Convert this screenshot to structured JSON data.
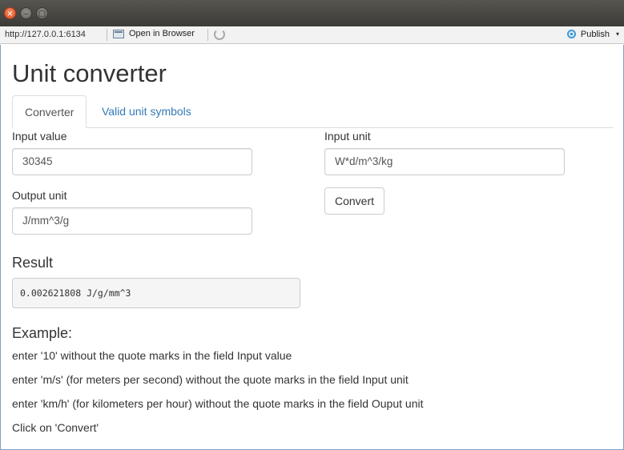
{
  "window": {
    "close_glyph": "×",
    "minimize_glyph": "–",
    "maximize_glyph": "▢"
  },
  "viewer": {
    "url": "http://127.0.0.1:6134",
    "open_in_browser": "Open in Browser",
    "publish": "Publish",
    "publish_caret": "▾"
  },
  "app": {
    "title": "Unit converter",
    "tabs": [
      {
        "label": "Converter",
        "active": true
      },
      {
        "label": "Valid unit symbols",
        "active": false
      }
    ],
    "input_value": {
      "label": "Input value",
      "value": "30345"
    },
    "input_unit": {
      "label": "Input unit",
      "value": "W*d/m^3/kg"
    },
    "output_unit": {
      "label": "Output unit",
      "value": "J/mm^3/g"
    },
    "convert_button": "Convert",
    "result": {
      "heading": "Result",
      "value": "0.002621808 J/g/mm^3"
    },
    "example": {
      "heading": "Example:",
      "lines": [
        "enter '10' without the quote marks in the field Input value",
        "enter 'm/s' (for meters per second) without the quote marks in the field Input unit",
        "enter 'km/h' (for kilometers per hour) without the quote marks in the field Ouput unit",
        "Click on 'Convert'"
      ]
    }
  },
  "colors": {
    "link": "#337ab7",
    "text": "#333333",
    "titlebar": "#3c3b37",
    "close_button": "#e0512a"
  }
}
